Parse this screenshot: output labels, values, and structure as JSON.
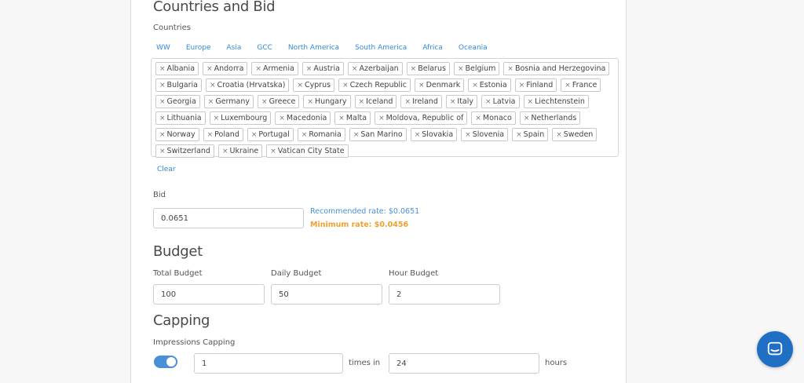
{
  "countries_section": {
    "title": "Countries and Bid",
    "countries_label": "Countries",
    "tabs": [
      "WW",
      "Europe",
      "Asia",
      "GCC",
      "North America",
      "South America",
      "Africa",
      "Oceania"
    ],
    "selected": [
      "Albania",
      "Andorra",
      "Armenia",
      "Austria",
      "Azerbaijan",
      "Belarus",
      "Belgium",
      "Bosnia and Herzegovina",
      "Bulgaria",
      "Croatia (Hrvatska)",
      "Cyprus",
      "Czech Republic",
      "Denmark",
      "Estonia",
      "Finland",
      "France",
      "Georgia",
      "Germany",
      "Greece",
      "Hungary",
      "Iceland",
      "Ireland",
      "Italy",
      "Latvia",
      "Liechtenstein",
      "Lithuania",
      "Luxembourg",
      "Macedonia",
      "Malta",
      "Moldova, Republic of",
      "Monaco",
      "Netherlands",
      "Norway",
      "Poland",
      "Portugal",
      "Romania",
      "San Marino",
      "Slovakia",
      "Slovenia",
      "Spain",
      "Sweden",
      "Switzerland",
      "Ukraine",
      "Vatican City State"
    ],
    "remove_glyph": "×",
    "clear_label": "Clear"
  },
  "bid": {
    "label": "Bid",
    "value": "0.0651",
    "recommended": "Recommended rate: $0.0651",
    "minimum": "Minimum rate: $0.0456",
    "recommended_color": "#4a90d9",
    "minimum_color": "#f0a030"
  },
  "budget": {
    "title": "Budget",
    "total_label": "Total Budget",
    "total_value": "100",
    "daily_label": "Daily Budget",
    "daily_value": "50",
    "hour_label": "Hour Budget",
    "hour_value": "2"
  },
  "capping": {
    "title": "Capping",
    "impressions_label": "Impressions Capping",
    "toggle_on": true,
    "times_value": "1",
    "times_in_label": "times in",
    "hours_value": "24",
    "hours_label": "hours"
  },
  "chat": {
    "icon": "chat-bubble-icon",
    "color": "#1f6fc4"
  }
}
